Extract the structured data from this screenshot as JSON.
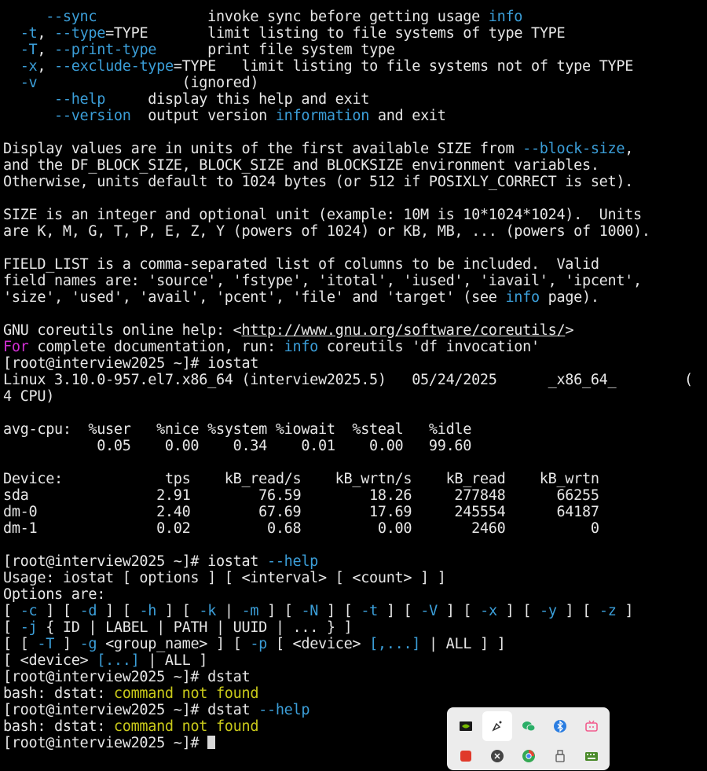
{
  "terminal": {
    "lines": [
      [
        {
          "t": "     "
        },
        {
          "t": "--sync",
          "c": "cyan"
        },
        {
          "t": "             invoke sync before getting usage "
        },
        {
          "t": "info",
          "c": "cyan"
        }
      ],
      [
        {
          "t": "  "
        },
        {
          "t": "-t",
          "c": "cyan"
        },
        {
          "t": ", "
        },
        {
          "t": "--type",
          "c": "cyan"
        },
        {
          "t": "=TYPE       limit listing to file systems of type TYPE"
        }
      ],
      [
        {
          "t": "  "
        },
        {
          "t": "-T",
          "c": "cyan"
        },
        {
          "t": ", "
        },
        {
          "t": "--print-type",
          "c": "cyan"
        },
        {
          "t": "      print file system type"
        }
      ],
      [
        {
          "t": "  "
        },
        {
          "t": "-x",
          "c": "cyan"
        },
        {
          "t": ", "
        },
        {
          "t": "--exclude-type",
          "c": "cyan"
        },
        {
          "t": "=TYPE   limit listing to file systems not of type TYPE"
        }
      ],
      [
        {
          "t": "  "
        },
        {
          "t": "-v",
          "c": "cyan"
        },
        {
          "t": "                 (ignored)"
        }
      ],
      [
        {
          "t": "      "
        },
        {
          "t": "--help",
          "c": "cyan"
        },
        {
          "t": "     display this help and exit"
        }
      ],
      [
        {
          "t": "      "
        },
        {
          "t": "--version",
          "c": "cyan"
        },
        {
          "t": "  output version "
        },
        {
          "t": "information",
          "c": "cyan"
        },
        {
          "t": " and exit"
        }
      ],
      [],
      [
        {
          "t": "Display values are in units of the first available SIZE from "
        },
        {
          "t": "--block-size",
          "c": "cyan"
        },
        {
          "t": ","
        }
      ],
      [
        {
          "t": "and the DF_BLOCK_SIZE, BLOCK_SIZE and BLOCKSIZE environment variables."
        }
      ],
      [
        {
          "t": "Otherwise, units default to 1024 bytes (or 512 if POSIXLY_CORRECT is set)."
        }
      ],
      [],
      [
        {
          "t": "SIZE is an integer and optional unit (example: 10M is 10*1024*1024).  Units"
        }
      ],
      [
        {
          "t": "are K, M, G, T, P, E, Z, Y (powers of 1024) or KB, MB, ... (powers of 1000)."
        }
      ],
      [],
      [
        {
          "t": "FIELD_LIST is a comma-separated list of columns to be included.  Valid"
        }
      ],
      [
        {
          "t": "field names are: 'source', 'fstype', 'itotal', 'iused', 'iavail', 'ipcent',"
        }
      ],
      [
        {
          "t": "'size', 'used', 'avail', 'pcent', 'file' and 'target' (see "
        },
        {
          "t": "info",
          "c": "cyan"
        },
        {
          "t": " page)."
        }
      ],
      [],
      [
        {
          "t": "GNU coreutils online help: <"
        },
        {
          "t": "http://www.gnu.org/software/coreutils/",
          "c": "link"
        },
        {
          "t": ">"
        }
      ],
      [
        {
          "t": "For",
          "c": "magenta"
        },
        {
          "t": " complete documentation, run: "
        },
        {
          "t": "info",
          "c": "cyan"
        },
        {
          "t": " coreutils 'df invocation'"
        }
      ],
      [
        {
          "t": "[root@interview2025 ~]# iostat"
        }
      ],
      [
        {
          "t": "Linux 3.10.0-957.el7.x86_64 (interview2025.5)   05/24/2025      _x86_64_        ("
        }
      ],
      [
        {
          "t": "4 CPU)"
        }
      ],
      [],
      [
        {
          "t": "avg-cpu:  %user   %nice %system %iowait  %steal   %idle"
        }
      ],
      [
        {
          "t": "           0.05    0.00    0.34    0.01    0.00   99.60"
        }
      ],
      [],
      [
        {
          "t": "Device:            tps    kB_read/s    kB_wrtn/s    kB_read    kB_wrtn"
        }
      ],
      [
        {
          "t": "sda               2.91        76.59        18.26     277848      66255"
        }
      ],
      [
        {
          "t": "dm-0              2.40        67.69        17.69     245554      64187"
        }
      ],
      [
        {
          "t": "dm-1              0.02         0.68         0.00       2460          0"
        }
      ],
      [],
      [
        {
          "t": "[root@interview2025 ~]# iostat "
        },
        {
          "t": "--help",
          "c": "cyan"
        }
      ],
      [
        {
          "t": "Usage: iostat [ options ] [ <interval> [ <count> ] ]"
        }
      ],
      [
        {
          "t": "Options are:"
        }
      ],
      [
        {
          "t": "[ "
        },
        {
          "t": "-c",
          "c": "cyan"
        },
        {
          "t": " ] [ "
        },
        {
          "t": "-d",
          "c": "cyan"
        },
        {
          "t": " ] [ "
        },
        {
          "t": "-h",
          "c": "cyan"
        },
        {
          "t": " ] [ "
        },
        {
          "t": "-k",
          "c": "cyan"
        },
        {
          "t": " | "
        },
        {
          "t": "-m",
          "c": "cyan"
        },
        {
          "t": " ] [ "
        },
        {
          "t": "-N",
          "c": "cyan"
        },
        {
          "t": " ] [ "
        },
        {
          "t": "-t",
          "c": "cyan"
        },
        {
          "t": " ] [ "
        },
        {
          "t": "-V",
          "c": "cyan"
        },
        {
          "t": " ] [ "
        },
        {
          "t": "-x",
          "c": "cyan"
        },
        {
          "t": " ] [ "
        },
        {
          "t": "-y",
          "c": "cyan"
        },
        {
          "t": " ] [ "
        },
        {
          "t": "-z",
          "c": "cyan"
        },
        {
          "t": " ]"
        }
      ],
      [
        {
          "t": "[ "
        },
        {
          "t": "-j",
          "c": "cyan"
        },
        {
          "t": " { ID | LABEL | PATH | UUID | ... } ]"
        }
      ],
      [
        {
          "t": "[ [ "
        },
        {
          "t": "-T",
          "c": "cyan"
        },
        {
          "t": " ] "
        },
        {
          "t": "-g",
          "c": "cyan"
        },
        {
          "t": " <group_name> ] [ "
        },
        {
          "t": "-p",
          "c": "cyan"
        },
        {
          "t": " [ <device> "
        },
        {
          "t": "[,...]",
          "c": "cyan"
        },
        {
          "t": " | ALL ] ]"
        }
      ],
      [
        {
          "t": "[ <device> "
        },
        {
          "t": "[...]",
          "c": "cyan"
        },
        {
          "t": " | ALL ]"
        }
      ],
      [
        {
          "t": "[root@interview2025 ~]# dstat"
        }
      ],
      [
        {
          "t": "bash: dstat: "
        },
        {
          "t": "command not found",
          "c": "yellow"
        }
      ],
      [
        {
          "t": "[root@interview2025 ~]# dstat "
        },
        {
          "t": "--help",
          "c": "cyan"
        }
      ],
      [
        {
          "t": "bash: dstat: "
        },
        {
          "t": "command not found",
          "c": "yellow"
        }
      ],
      [
        {
          "t": "[root@interview2025 ~]# "
        },
        {
          "t": "",
          "cursor": true
        }
      ]
    ],
    "colors": {
      "cyan": "#3b9ed8",
      "magenta": "#d12fd2",
      "yellow": "#c9c91a",
      "text": "#e6e6e6",
      "background": "#000000"
    }
  },
  "tray": {
    "icons": [
      {
        "name": "nvidia-icon",
        "color": "#76b900"
      },
      {
        "name": "pen-tool-icon",
        "color": "#333333",
        "active": true
      },
      {
        "name": "wechat-icon",
        "color": "#2aae67"
      },
      {
        "name": "bluetooth-icon",
        "color": "#2a7de1"
      },
      {
        "name": "bilibili-icon",
        "color": "#f25d8e"
      },
      {
        "name": "red-app-icon",
        "color": "#e03a2b"
      },
      {
        "name": "gray-app-icon",
        "color": "#444444"
      },
      {
        "name": "chrome-icon",
        "color": "#34a853"
      },
      {
        "name": "usb-drive-icon",
        "color": "#555555"
      },
      {
        "name": "keyboard-icon",
        "color": "#4a8a2a"
      }
    ]
  }
}
